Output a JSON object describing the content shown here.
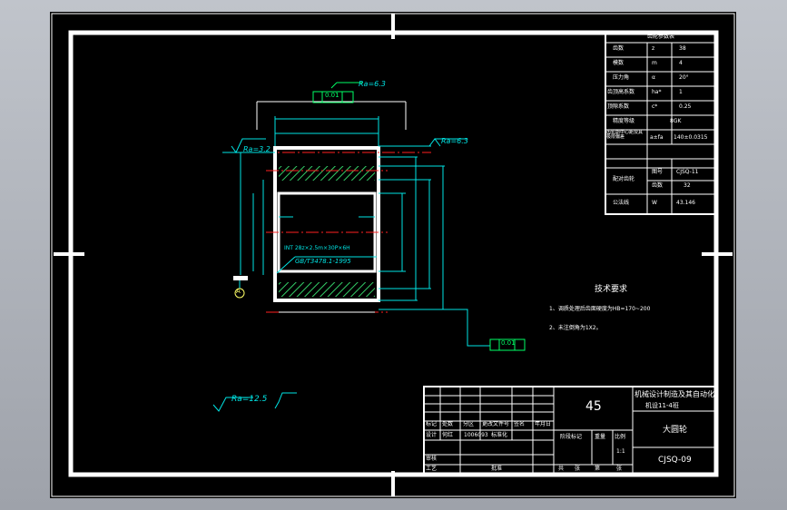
{
  "colors": {
    "background": "#000000",
    "frame": "#ffffff",
    "dimension": "#00e5e5",
    "centerline": "#ff2020",
    "hatch": "#33cc66",
    "tolerance": "#00ff66",
    "viewport": "#b5b9c1"
  },
  "surface_roughness": {
    "top": "Ra=6.3",
    "right": "Ra=6.3",
    "left": "Ra=3.2",
    "default": "Ra=12.5"
  },
  "drawing": {
    "tolerance_top": "0.01",
    "tolerance_right": "0.01",
    "spline_note": "INT 28z×2.5m×30P×6H",
    "standard": "GB/T3478.1-1995",
    "datum_mark": "A"
  },
  "tech_requirements": {
    "title": "技术要求",
    "items": [
      "1、调质处理后齿面硬度为HB=170~200",
      "2、未注倒角为1X2。"
    ]
  },
  "param_table": {
    "title": "齿轮参数表",
    "rows": [
      [
        "齿数",
        "z",
        "38"
      ],
      [
        "模数",
        "m",
        "4"
      ],
      [
        "压力角",
        "α",
        "20°"
      ],
      [
        "齿顶高系数",
        "ha*",
        "1"
      ],
      [
        "顶隙系数",
        "c*",
        "0.25"
      ],
      [
        "精度等级",
        "",
        "8GK"
      ],
      [
        "齿轮副中心距及其极限偏差",
        "a±fa",
        "140±0.0315"
      ],
      [
        "配对齿轮",
        "图号",
        "CJSQ-11"
      ],
      [
        "",
        "齿数",
        "32"
      ],
      [
        "公法线",
        "W",
        "43.146"
      ]
    ]
  },
  "title_block": {
    "company": "机械设计制造及其自动化",
    "class": "机设11-4班",
    "material": "45",
    "part_name": "大圆轮",
    "drawing_no": "CJSQ-09",
    "designer_id": "1006093",
    "designer_name": "何红",
    "headers": {
      "mark": "标记",
      "count": "处数",
      "zone": "分区",
      "doc": "更改文件号",
      "sign": "签名",
      "date": "年月日",
      "design": "设计",
      "stdize": "标准化",
      "stage": "阶段标记",
      "weight": "重量",
      "scale": "比例",
      "review": "审核",
      "process": "工艺",
      "approve": "批准",
      "sheets": "共",
      "sheet_unit": "张",
      "of": "第",
      "scale_val": "1:1"
    }
  }
}
